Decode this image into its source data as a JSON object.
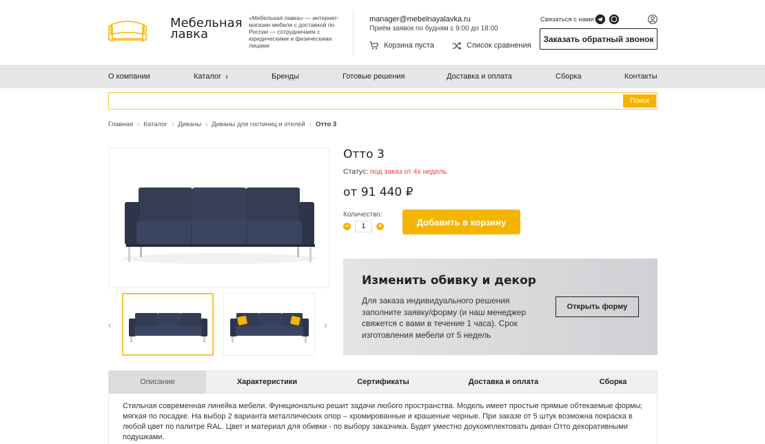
{
  "header": {
    "logo_line1": "Мебельная",
    "logo_line2": "лавка",
    "tagline": "«Мебельная лавка» — интернет-магазин мебели с доставкой по России — сотрудничаем с юридическими и физическими лицами",
    "email": "manager@mebelnayalavka.ru",
    "hours": "Приём заявок по будням с 9:00 до 18:00",
    "cart_label": "Корзина пуста",
    "compare_label": "Список сравнения",
    "contact_label": "Связаться с нами:",
    "callback_button": "Заказать обратный звонок",
    "accent_color": "#f5b400"
  },
  "nav": {
    "items": [
      "О компании",
      "Каталог",
      "Бренды",
      "Готовые решения",
      "Доставка и оплата",
      "Сборка",
      "Контакты"
    ]
  },
  "search": {
    "value": "",
    "button": "Поиск"
  },
  "breadcrumb": {
    "items": [
      "Главная",
      "Каталог",
      "Диваны",
      "Диваны для гостиниц и отелей"
    ],
    "current": "Отто 3"
  },
  "product": {
    "title": "Отто 3",
    "status_label": "Статус:",
    "status_value": "под заказ от 4х недель",
    "price": "от 91 440 ₽",
    "qty_label": "Количество:",
    "qty_value": "1",
    "add_to_cart": "Добавить в корзину"
  },
  "custom": {
    "title": "Изменить обивку и декор",
    "text": "Для заказа индивидуального решения заполните заявку/форму (и наш менеджер свяжется с вами в течение 1 часа). Срок изготовления мебели от 5 недель",
    "button": "Открыть форму"
  },
  "tabs": {
    "items": [
      "Описание",
      "Характеристики",
      "Сертификаты",
      "Доставка и оплата",
      "Сборка"
    ],
    "active": "Описание"
  },
  "description": "Стильная современная линейка мебели. Функционально решит задачи любого пространства. Модель имеет простые прямые обтекаемые формы; мягкая по посадке. На выбор 2 варианта металлических опор – хромированные и крашеные черные. При заказе от 5 штук возможна покраска в любой цвет по палитре RAL. Цвет и материал для обивки - по выбору заказчика. Будет уместно доукомплектовать диван Отто декоративными подушками."
}
